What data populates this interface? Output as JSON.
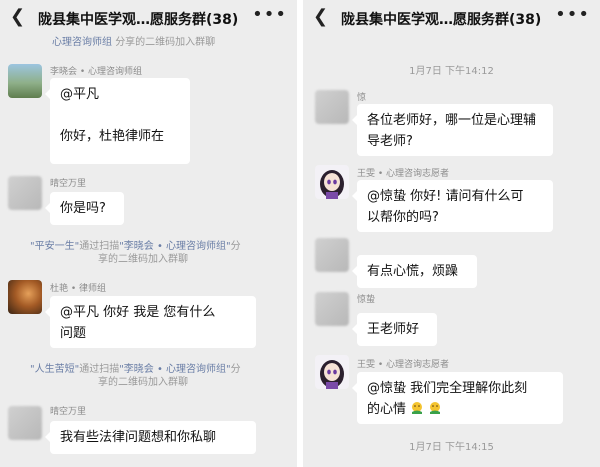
{
  "left_chat": {
    "title": "陇县集中医学观…愿服务群(38)",
    "back_icon": "back-chevron-icon",
    "more_icon": "more-dots-icon",
    "top_notice": {
      "highlight": "心理咨询师组",
      "text": "分享的二维码加入群聊"
    },
    "messages": [
      {
        "sender": "李晓会 • 心理咨询师组",
        "lines": [
          "@平凡",
          "",
          "你好，杜艳律师在"
        ]
      },
      {
        "sender": "晴空万里",
        "lines": [
          "你是吗?"
        ]
      },
      {
        "sender": "杜艳 • 律师组",
        "lines": [
          "@平凡  你好  我是 您有什么",
          "问题"
        ]
      },
      {
        "sender": "晴空万里",
        "lines": [
          "我有些法律问题想和你私聊"
        ]
      }
    ],
    "join_notices": [
      {
        "name": "\"平安一生\"",
        "via": "通过扫描",
        "inviter": "\"李晓会 • 心理咨询师组\"",
        "tail": "分",
        "line2": "享的二维码加入群聊"
      },
      {
        "name": "\"人生苦短\"",
        "via": "通过扫描",
        "inviter": "\"李晓会 • 心理咨询师组\"",
        "tail": "分",
        "line2": "享的二维码加入群聊"
      }
    ]
  },
  "right_chat": {
    "title": "陇县集中医学观…愿服务群(38)",
    "back_icon": "back-chevron-icon",
    "more_icon": "more-dots-icon",
    "timestamps": [
      "1月7日 下午14:12",
      "1月7日 下午14:15"
    ],
    "messages": [
      {
        "sender": "惊",
        "lines": [
          "各位老师好，哪一位是心理辅",
          "导老师?"
        ]
      },
      {
        "sender": "王雯 • 心理咨询志愿者",
        "lines": [
          "@惊蛰  你好! 请问有什么可",
          "以帮你的吗?"
        ]
      },
      {
        "sender": "",
        "lines": [
          "有点心慌，烦躁"
        ]
      },
      {
        "sender": "惊蛰",
        "lines": [
          "王老师好"
        ]
      },
      {
        "sender": "王雯 • 心理咨询志愿者",
        "lines": [
          "@惊蛰  我们完全理解你此刻",
          "的心情"
        ]
      }
    ],
    "emoji_names": [
      "hug-emoji-icon",
      "hug-emoji-icon"
    ]
  },
  "colors": {
    "chat_bg": "#ededed",
    "bubble_bg": "#ffffff",
    "system_text": "#9a9a9a",
    "highlight_text": "#6a7ea6"
  }
}
